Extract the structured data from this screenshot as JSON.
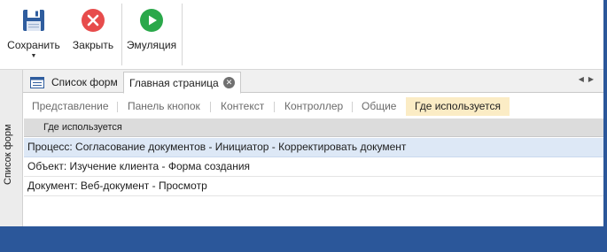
{
  "ribbon": {
    "buttons": [
      {
        "label": "Сохранить",
        "icon": "save-disk-icon"
      },
      {
        "label": "Закрыть",
        "icon": "close-circle-icon"
      },
      {
        "label": "Эмуляция",
        "icon": "play-circle-icon"
      }
    ],
    "colors": {
      "save": "#2f5d9e",
      "close": "#e74c4c",
      "play": "#2aa84a"
    }
  },
  "sidebar": {
    "label": "Список форм"
  },
  "doc_tabs": [
    {
      "label": "Список форм",
      "active": false
    },
    {
      "label": "Главная страница",
      "active": true
    }
  ],
  "sub_tabs": [
    {
      "label": "Представление"
    },
    {
      "label": "Панель кнопок"
    },
    {
      "label": "Контекст"
    },
    {
      "label": "Контроллер"
    },
    {
      "label": "Общие"
    },
    {
      "label": "Где используется",
      "selected": true
    }
  ],
  "grid": {
    "column_header": "Где используется",
    "rows": [
      {
        "text": "Процесс: Согласование документов - Инициатор - Корректировать документ",
        "selected": true
      },
      {
        "text": "Объект: Изучение клиента - Форма создания",
        "selected": false
      },
      {
        "text": "Документ: Веб-документ - Просмотр",
        "selected": false
      }
    ]
  },
  "accent_color": "#2b579a"
}
